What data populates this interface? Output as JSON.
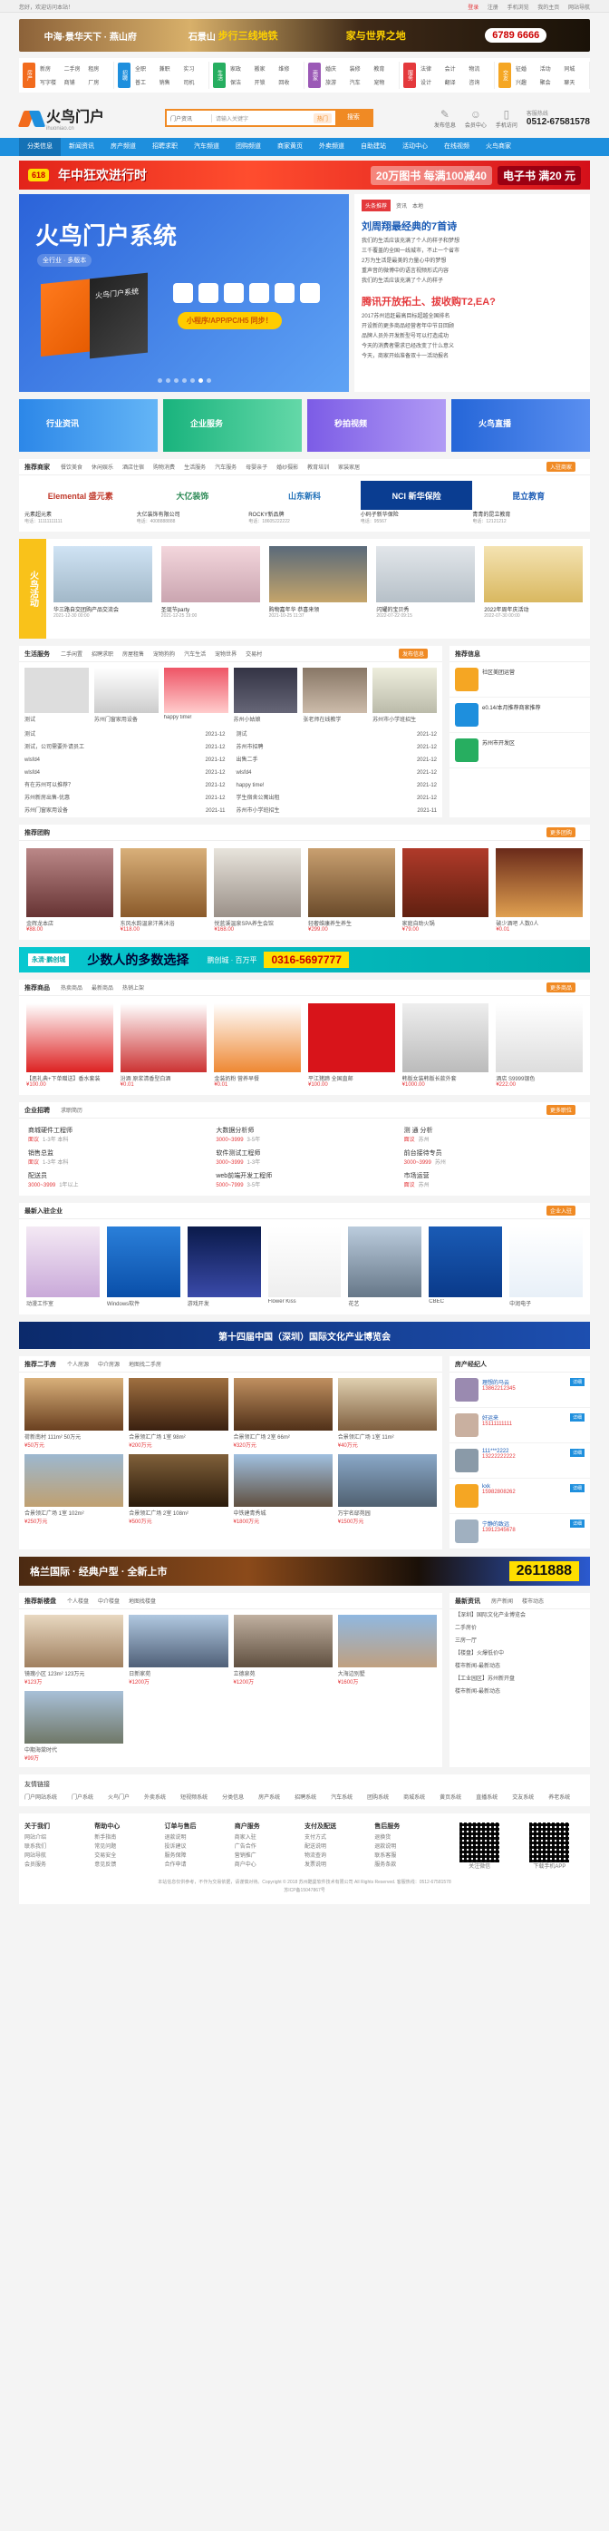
{
  "topbar": {
    "left": "您好，欢迎访问本站！",
    "links": [
      "登录",
      "注册",
      "手机浏览",
      "我的主页",
      "网站导航"
    ]
  },
  "ad_top": {
    "a": "中海·景华天下 · 燕山府",
    "b": "石景山",
    "c": "步行三线地铁",
    "d": "家与世界之地",
    "phone": "6789 6666"
  },
  "catnav": [
    {
      "icon": "房产",
      "items": [
        "新房",
        "二手房",
        "租房",
        "写字楼",
        "商铺",
        "厂房"
      ]
    },
    {
      "icon": "招聘",
      "items": [
        "全职",
        "兼职",
        "实习",
        "普工",
        "销售",
        "司机"
      ]
    },
    {
      "icon": "生活",
      "items": [
        "家政",
        "搬家",
        "维修",
        "保洁",
        "开锁",
        "回收"
      ]
    },
    {
      "icon": "商家",
      "items": [
        "婚庆",
        "装修",
        "教育",
        "旅游",
        "汽车",
        "宠物"
      ]
    },
    {
      "icon": "服务",
      "items": [
        "法律",
        "会计",
        "物流",
        "设计",
        "翻译",
        "咨询"
      ]
    },
    {
      "icon": "交友",
      "items": [
        "征婚",
        "活动",
        "同城",
        "兴趣",
        "聚会",
        "聊天"
      ]
    }
  ],
  "header": {
    "logo": "火鸟门户",
    "logo_sub": "ihuoniao.cn",
    "search_select": "门户资讯",
    "search_placeholder": "请输入关键字",
    "hot": "热门",
    "search_btn": "搜索",
    "icons": [
      "发布信息",
      "会员中心",
      "手机访问"
    ],
    "tel_label": "客服热线",
    "tel": "0512-67581578"
  },
  "nav": [
    "分类信息",
    "新闻资讯",
    "房产频道",
    "招聘求职",
    "汽车频道",
    "团购频道",
    "商家黄页",
    "外卖频道",
    "自助建站",
    "活动中心",
    "在线视频",
    "火鸟商家"
  ],
  "promo": {
    "tag": "618",
    "t1": "年中狂欢进行时",
    "t2": "20万图书 每满100减40",
    "t3": "电子书 满20 元"
  },
  "slide": {
    "title": "火鸟门户系统",
    "sub": "全行业 · 多版本",
    "box": "火鸟门户系统",
    "strip": "小程序/APP/PC/H5 同步！"
  },
  "news": {
    "tabs": [
      "头条推荐",
      "资讯",
      "本地"
    ],
    "h1": "刘周翔最经典的7首诗",
    "h2": "腾讯开放拓土、拔收购T2,EA?",
    "list1": [
      "我们的生活应该充满了个人的样子和梦想",
      "三千覆盖的全国一线城市，不止一个省市",
      "2万为生活是最美的力量心中的梦想",
      "重声音的微博中的语言视频形式内容",
      "我们的生活应该充满了个人的样子"
    ],
    "list2": [
      "2017苏州追赶最高目标超越全国排名",
      "开设新的更多商品经营者年中节日回顾",
      "品牌人员外开发新型号可以打造成功",
      "今天的消费者需求已经改变了什么意义",
      "今天，商家开始准备双十一活动报名"
    ]
  },
  "feat": [
    "行业资讯",
    "企业服务",
    "秒拍视频",
    "火鸟直播"
  ],
  "brands": {
    "title": "推荐商家",
    "tabs": [
      "餐饮美食",
      "休闲娱乐",
      "酒店住宿",
      "购物消费",
      "生活服务",
      "汽车服务",
      "母婴亲子",
      "婚纱摄影",
      "教育培训",
      "家装家居"
    ],
    "more": "入驻商家",
    "items": [
      {
        "logo": "Elemental 盛元素",
        "n": "元素超元素",
        "d": "电话：11111111111"
      },
      {
        "logo": "大亿装饰",
        "n": "大亿装饰有限公司",
        "d": "电话：4008888888"
      },
      {
        "logo": "山东新科",
        "n": "ROCKY新品牌",
        "d": "电话：18605222222"
      },
      {
        "logo": "NCI 新华保险",
        "n": "小码子新华保险",
        "d": "电话：95567"
      },
      {
        "logo": "昆立教育",
        "n": "青青的昆立教育",
        "d": "电话：12121212"
      }
    ]
  },
  "activity": {
    "label": "火鸟活动",
    "items": [
      {
        "n": "华三路自交团购产品交流会",
        "d": "2021-12-30 00:00"
      },
      {
        "n": "圣诞节party",
        "d": "2021-12-25 19:00"
      },
      {
        "n": "购物嘉年华 恭喜来领",
        "d": "2021-10-25 11:37"
      },
      {
        "n": "闪耀的宝贝秀",
        "d": "2022-07-22 09:15"
      },
      {
        "n": "2022年周年庆活动",
        "d": "2022-07-30 00:00"
      }
    ]
  },
  "info": {
    "tabs": [
      "生活服务",
      "二手闲置",
      "招聘求职",
      "房屋租售",
      "宠物狗狗",
      "汽车生活",
      "宠物世界",
      "交易村"
    ],
    "more": "发布信息",
    "pics": [
      "测试",
      "苏州门窗家用设备",
      "happy time!",
      "苏州小姑娘",
      "张老师在线教学",
      "苏州市小学班招生"
    ],
    "list": [
      {
        "t": "测试",
        "d": "2021-12"
      },
      {
        "t": "测试",
        "d": "2021-12"
      },
      {
        "t": "测试，公司需要外请员工",
        "d": "2021-12"
      },
      {
        "t": "苏州市招聘",
        "d": "2021-12"
      },
      {
        "t": "wlsfd4",
        "d": "2021-12"
      },
      {
        "t": "出售二手",
        "d": "2021-12"
      },
      {
        "t": "wlsfd4",
        "d": "2021-12"
      },
      {
        "t": "wlsfd4",
        "d": "2021-12"
      },
      {
        "t": "有在苏州可以推荐？",
        "d": "2021-12"
      },
      {
        "t": "happy time!",
        "d": "2021-12"
      },
      {
        "t": "苏州新房出售-优惠",
        "d": "2021-12"
      },
      {
        "t": "学生宿舍公寓出租",
        "d": "2021-12"
      },
      {
        "t": "苏州门窗家用设备",
        "d": "2021-11"
      },
      {
        "t": "苏州市小学班招生",
        "d": "2021-11"
      }
    ],
    "side_title": "推荐信息",
    "side_items": [
      "社区美团运营",
      "e0.14/本月推荐商家推荐",
      "苏州市开发区"
    ]
  },
  "tuan": {
    "title": "推荐团购",
    "more": "更多团购",
    "items": [
      {
        "n": "金辉龙本店",
        "p": "¥88.00"
      },
      {
        "n": "东风水韵温泉汗蒸沐浴",
        "p": "¥118.00"
      },
      {
        "n": "悦蓝溪温泉SPA养生会馆",
        "p": "¥168.00"
      },
      {
        "n": "轻奢维康养生养生",
        "p": "¥299.00"
      },
      {
        "n": "家庭自助火锅",
        "p": "¥79.00"
      },
      {
        "n": "破少酒吧 人数0人",
        "p": "¥0.01"
      }
    ]
  },
  "ad_mid": {
    "logo": "永清·鹏创城",
    "t": "少数人的多数选择",
    "s": "鹏创城 · 百万平",
    "phone": "0316-5697777"
  },
  "shop": {
    "tabs": [
      "推荐商品",
      "热卖商品",
      "最新商品",
      "热销上架"
    ],
    "more": "更多商品",
    "items": [
      {
        "n": "【恶礼典+下单赠送】香水套装",
        "p": "¥100.00"
      },
      {
        "n": "汾酒 原浆清香型白酒",
        "p": "¥0.01"
      },
      {
        "n": "金装奶粉 营养早餐",
        "p": "¥0.01"
      },
      {
        "n": "平江猪蹄 全国直邮",
        "p": "¥100.00"
      },
      {
        "n": "韩版女装韩版长款外套",
        "p": "¥1000.00"
      },
      {
        "n": "酒店 S9999银色",
        "p": "¥222.00"
      }
    ]
  },
  "job": {
    "title": "企业招聘",
    "tabs": [
      "求职简历"
    ],
    "more": "更多职位",
    "items": [
      {
        "t": "商城硬件工程师",
        "s": "面议",
        "e": "1-3年 本科"
      },
      {
        "t": "大数据分析师",
        "s": "3000~3999",
        "e": "3-5年"
      },
      {
        "t": "测 通 分析",
        "s": "面议",
        "e": "苏州"
      },
      {
        "t": "销售总监",
        "s": "面议",
        "e": "1-3年 本科"
      },
      {
        "t": "软件测试工程师",
        "s": "3000~3999",
        "e": "1-3年"
      },
      {
        "t": "前台接待专员",
        "s": "3000~3999",
        "e": "苏州"
      },
      {
        "t": "配送员",
        "s": "3000~3999",
        "e": "1年以上"
      },
      {
        "t": "web前端开发工程师",
        "s": "5000~7999",
        "e": "3-5年"
      },
      {
        "t": "市场运营",
        "s": "面议",
        "e": "苏州"
      }
    ]
  },
  "companies": {
    "title": "最新入驻企业",
    "more": "企业入驻",
    "items": [
      "动漫工作室",
      "Windows软件",
      "游戏开发",
      "Flower Kiss",
      "花艺",
      "CBEC",
      "中润电子"
    ]
  },
  "expo": {
    "t": "第十四届中国（深圳）国际文化产业博览会"
  },
  "house": {
    "title": "推荐二手房",
    "tabs": [
      "个人房源",
      "中介房源",
      "地图找二手房"
    ],
    "items": [
      {
        "n": "荷新南村 111m² 50万元",
        "p": "¥50万元"
      },
      {
        "n": "合景领汇广场 1室 98m²",
        "p": "¥200万元"
      },
      {
        "n": "合景领汇广场 2室 66m²",
        "p": "¥320万元"
      },
      {
        "n": "合景领汇广场 1室 11m²",
        "p": "¥40万元"
      },
      {
        "n": "合景领汇广场 1室 102m²",
        "p": "¥250万元"
      },
      {
        "n": "合景领汇广场 2室 108m²",
        "p": "¥500万元"
      },
      {
        "n": "中铁建青秀城",
        "p": "¥1800万元"
      },
      {
        "n": "万宇名邸苑园",
        "p": "¥1500万元"
      }
    ],
    "side_title": "房产经纪人",
    "agents": [
      {
        "n": "理想的马云",
        "p": "13862212345"
      },
      {
        "n": "好运来",
        "p": "15111111111"
      },
      {
        "n": "111***2222",
        "p": "13222222222"
      },
      {
        "n": "kxk",
        "p": "15982808262"
      },
      {
        "n": "宁静的致远",
        "p": "13912345678"
      }
    ],
    "detail": "详细"
  },
  "ad_low": {
    "t": "格兰国际 · 经典户型 · 全新上市",
    "phone": "2611888"
  },
  "newhouse": {
    "title": "推荐新楼盘",
    "tabs": [
      "个人楼盘",
      "中介楼盘",
      "地图找楼盘"
    ],
    "items": [
      {
        "n": "镜瑰小区 123m² 123万元",
        "p": "¥123万"
      },
      {
        "n": "日新家苑",
        "p": "¥1200万"
      },
      {
        "n": "立德泉苑",
        "p": "¥1200万"
      },
      {
        "n": "大海边别墅",
        "p": "¥1600万"
      },
      {
        "n": "中期海棠时代",
        "p": "¥99万"
      }
    ],
    "side_tabs": [
      "最新资讯",
      "房产新闻",
      "楼市动态"
    ],
    "side_list": [
      "【深圳】国际文化产业博览会",
      "二手房价",
      "三房一厅",
      "【楼盘】火爆低价中",
      "楼市新闻-最新动态",
      "【工业园区】苏州新开盘",
      "楼市新闻-最新动态"
    ]
  },
  "friend": {
    "title": "友情链接",
    "items": [
      "门户网站系统",
      "门户系统",
      "火鸟门户",
      "外卖系统",
      "短视频系统",
      "分类信息",
      "房产系统",
      "招聘系统",
      "汽车系统",
      "团购系统",
      "商城系统",
      "黄页系统",
      "直播系统",
      "交友系统",
      "养老系统"
    ]
  },
  "footer": {
    "cols": [
      {
        "h": "关于我们",
        "i": [
          "网站介绍",
          "联系我们",
          "网站导航",
          "会员服务"
        ]
      },
      {
        "h": "帮助中心",
        "i": [
          "新手指南",
          "常见问题",
          "交易安全",
          "意见反馈"
        ]
      },
      {
        "h": "订单与售后",
        "i": [
          "退款说明",
          "投诉建议",
          "服务保障",
          "合作申请"
        ]
      },
      {
        "h": "商户服务",
        "i": [
          "商家入驻",
          "广告合作",
          "营销推广",
          "商户中心"
        ]
      },
      {
        "h": "支付及配送",
        "i": [
          "支付方式",
          "配送说明",
          "物流查询",
          "发票说明"
        ]
      },
      {
        "h": "售后服务",
        "i": [
          "退换货",
          "退款说明",
          "联系客服",
          "服务条款"
        ]
      }
    ],
    "qr1": "关注微信",
    "qr2": "下载手机APP",
    "copy": "本站信息仅供参考，不作为交易依据，请谨慎对待。Copyright © 2018 苏州酷曼软件技术有限公司 All Rights Reserved. 客服热线：0512-67581578",
    "icp": "苏ICP备15047867号"
  }
}
